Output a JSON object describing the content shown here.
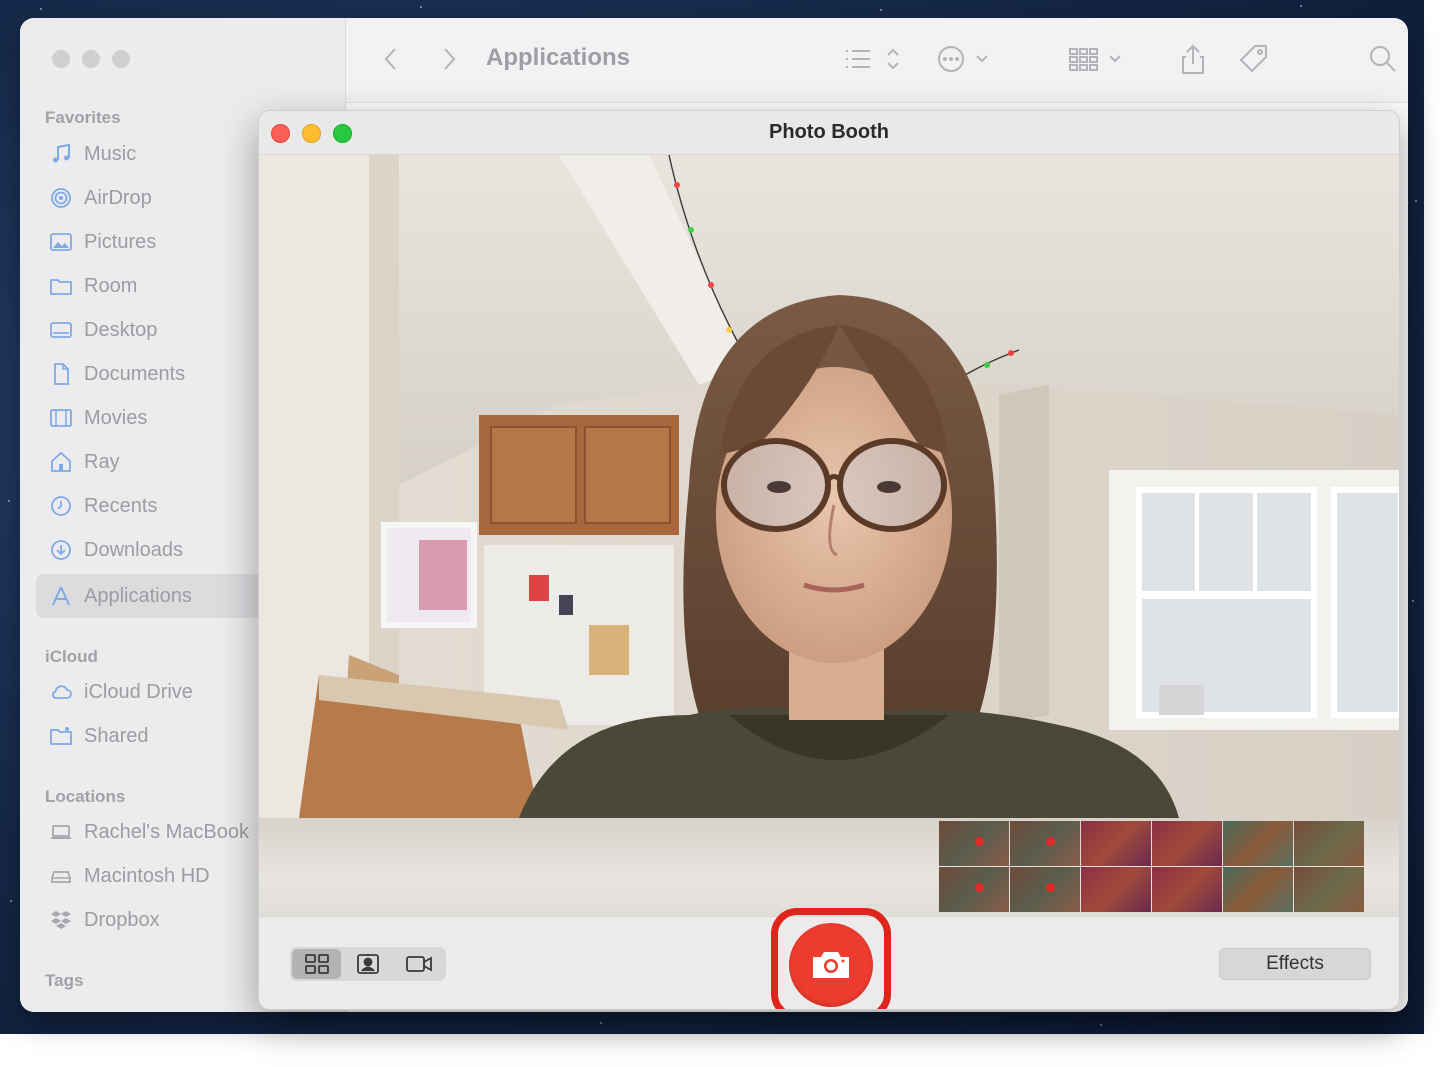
{
  "finder": {
    "title": "Applications",
    "toolbar_icons": [
      "chevron-left-icon",
      "chevron-right-icon",
      "list-view-icon",
      "more-options-icon",
      "group-icon",
      "share-icon",
      "tag-icon",
      "search-icon"
    ],
    "sections": {
      "favorites": "Favorites",
      "icloud": "iCloud",
      "locations": "Locations",
      "tags": "Tags"
    },
    "favorites": [
      {
        "label": "Music",
        "icon": "music-note-icon"
      },
      {
        "label": "AirDrop",
        "icon": "airdrop-icon"
      },
      {
        "label": "Pictures",
        "icon": "pictures-icon"
      },
      {
        "label": "Room",
        "icon": "folder-icon"
      },
      {
        "label": "Desktop",
        "icon": "desktop-icon"
      },
      {
        "label": "Documents",
        "icon": "document-icon"
      },
      {
        "label": "Movies",
        "icon": "film-icon"
      },
      {
        "label": "Ray",
        "icon": "home-icon"
      },
      {
        "label": "Recents",
        "icon": "clock-icon"
      },
      {
        "label": "Downloads",
        "icon": "download-icon"
      },
      {
        "label": "Applications",
        "icon": "applications-icon",
        "selected": true
      }
    ],
    "icloud_items": [
      {
        "label": "iCloud Drive",
        "icon": "cloud-icon"
      },
      {
        "label": "Shared",
        "icon": "shared-folder-icon"
      }
    ],
    "locations_items": [
      {
        "label": "Rachel's MacBook",
        "icon": "laptop-icon"
      },
      {
        "label": "Macintosh HD",
        "icon": "disk-icon"
      },
      {
        "label": "Dropbox",
        "icon": "dropbox-icon"
      }
    ]
  },
  "photobooth": {
    "title": "Photo Booth",
    "view_modes": [
      {
        "name": "grid-view-icon",
        "active": true
      },
      {
        "name": "single-photo-icon",
        "active": false
      },
      {
        "name": "video-icon",
        "active": false
      }
    ],
    "shutter_icon": "camera-icon",
    "effects_label": "Effects",
    "accent": "#ee3b2f",
    "highlight": "#e0241b"
  }
}
